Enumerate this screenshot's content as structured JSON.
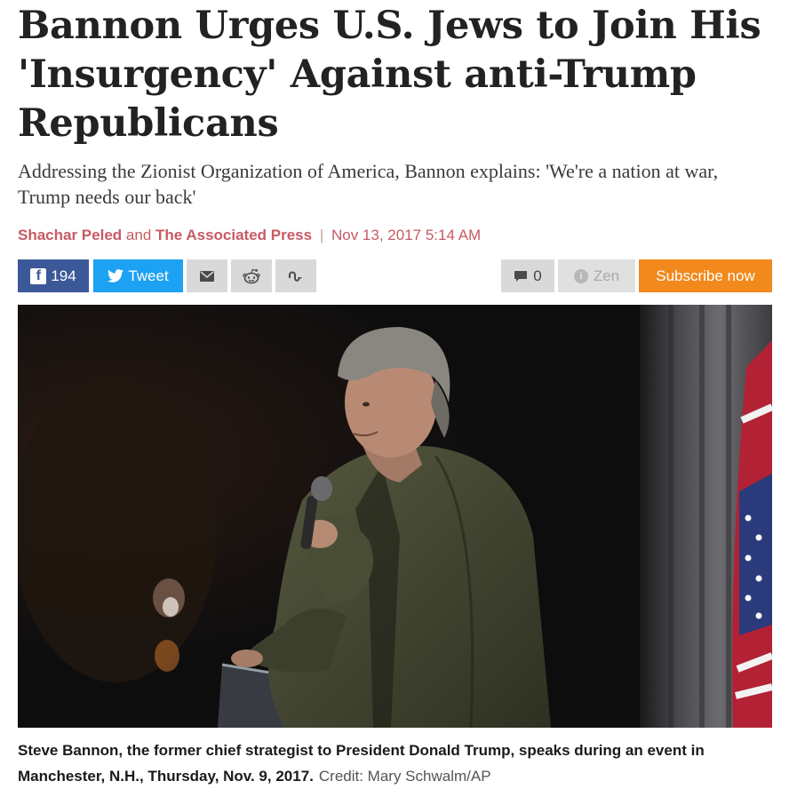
{
  "article": {
    "headline": "Bannon Urges U.S. Jews to Join His 'Insurgency' Against anti-Trump Republicans",
    "subheadline": "Addressing the Zionist Organization of America, Bannon explains: 'We're a nation at war, Trump needs our back'",
    "byline": {
      "author1": "Shachar Peled",
      "conjunction": "and",
      "author2": "The Associated Press",
      "separator": "|",
      "date": "Nov 13, 2017 5:14 AM"
    }
  },
  "toolbar": {
    "facebook": {
      "icon": "facebook-icon",
      "count": "194",
      "color": "#3b5998"
    },
    "twitter": {
      "icon": "twitter-bird-icon",
      "label": "Tweet",
      "color": "#1da1f2"
    },
    "email": {
      "icon": "envelope-icon"
    },
    "reddit": {
      "icon": "reddit-alien-icon"
    },
    "stumbleupon": {
      "icon": "stumbleupon-icon"
    },
    "comments": {
      "icon": "comment-bubble-icon",
      "count": "0"
    },
    "zen": {
      "icon": "zen-info-icon",
      "label": "Zen"
    },
    "subscribe": {
      "label": "Subscribe now",
      "color": "#f2891d"
    }
  },
  "photo": {
    "subject": "Steve Bannon speaking into a microphone at a podium, American flag at right"
  },
  "caption": {
    "text": "Steve Bannon, the former chief strategist to President Donald Trump, speaks during an event in Manchester, N.H., Thursday, Nov. 9, 2017.",
    "credit": "Credit: Mary Schwalm/AP"
  },
  "colors": {
    "byline": "#c85a64",
    "headline": "#222222",
    "icon_buttons": "#d9d9d9"
  }
}
